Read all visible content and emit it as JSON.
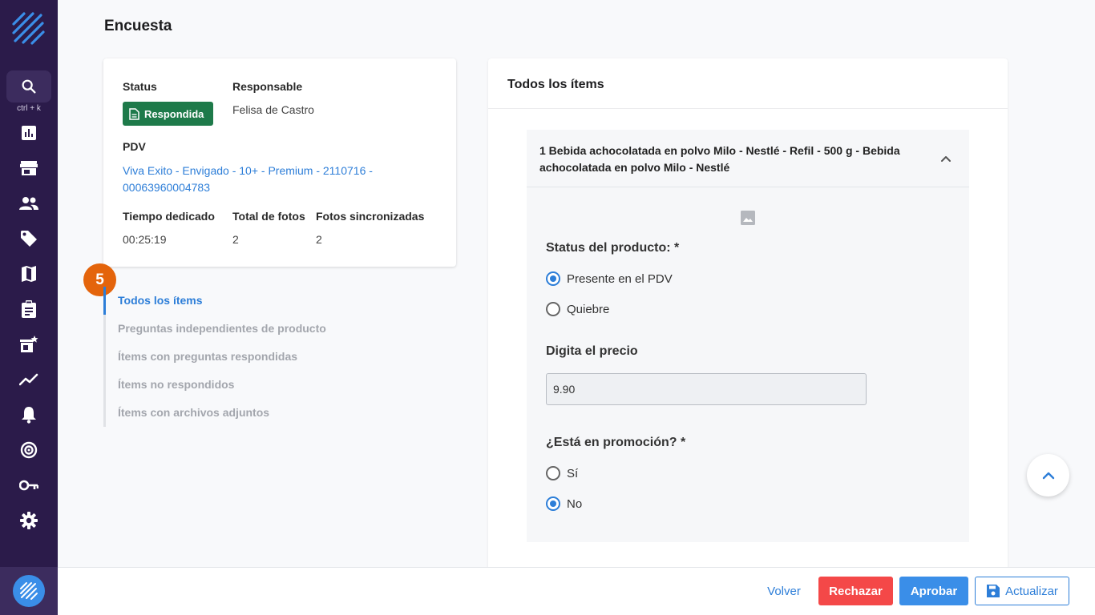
{
  "sidebar": {
    "shortcut": "ctrl + k",
    "icons": [
      "dashboard-icon",
      "store-icon",
      "users-icon",
      "tag-icon",
      "map-icon",
      "clipboard-icon",
      "store-star-icon",
      "trending-icon",
      "bell-icon",
      "target-icon",
      "key-icon",
      "gear-icon"
    ]
  },
  "page": {
    "title": "Encuesta"
  },
  "info": {
    "status_label": "Status",
    "status_value": "Respondida",
    "responsable_label": "Responsable",
    "responsable_value": "Felisa de Castro",
    "pdv_label": "PDV",
    "pdv_value": "Viva Exito - Envigado - 10+ - Premium - 2110716 - 00063960004783",
    "tiempo_label": "Tiempo dedicado",
    "tiempo_value": "00:25:19",
    "fotos_label": "Total de fotos",
    "fotos_value": "2",
    "sync_label": "Fotos sincronizadas",
    "sync_value": "2"
  },
  "step": "5",
  "filters": [
    {
      "label": "Todos los ítems",
      "active": true
    },
    {
      "label": "Preguntas independientes de producto",
      "active": false
    },
    {
      "label": "Ítems con preguntas respondidas",
      "active": false
    },
    {
      "label": "Ítems no respondidos",
      "active": false
    },
    {
      "label": "Ítems con archivos adjuntos",
      "active": false
    }
  ],
  "panel": {
    "title": "Todos los ítems",
    "item": {
      "title": "1 Bebida achocolatada en polvo Milo - Nestlé - Refil - 500 g - Bebida achocolatada en polvo Milo - Nestlé",
      "q1_label": "Status del producto: *",
      "q1_options": [
        "Presente en el PDV",
        "Quiebre"
      ],
      "q1_selected": "Presente en el PDV",
      "q2_label": "Digita el precio",
      "q2_value": "9.90",
      "q3_label": "¿Está en promoción? *",
      "q3_options": [
        "Sí",
        "No"
      ],
      "q3_selected": "No"
    }
  },
  "footer": {
    "back": "Volver",
    "reject": "Rechazar",
    "approve": "Aprobar",
    "update": "Actualizar"
  },
  "colors": {
    "sidebar": "#2b1b4a",
    "accent": "#2d7ed8",
    "status_green": "#1e7a4a",
    "reject_red": "#f44848",
    "step_orange": "#e4640b"
  }
}
